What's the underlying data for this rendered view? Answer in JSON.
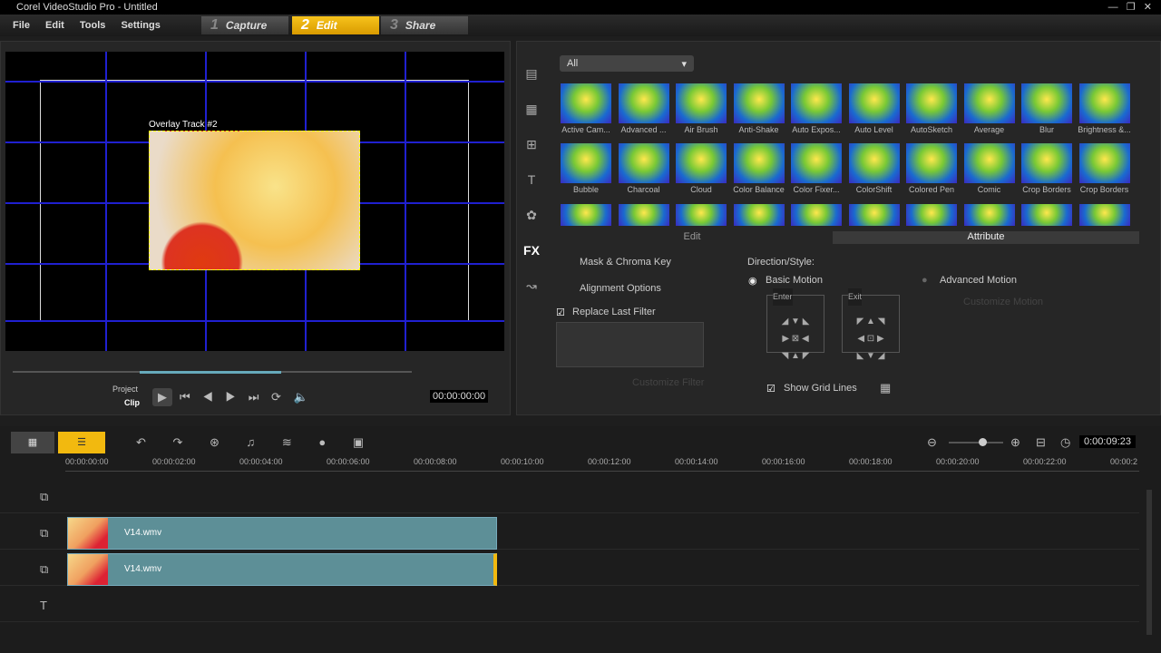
{
  "window": {
    "title": "Corel VideoStudio Pro - Untitled"
  },
  "menu": [
    "File",
    "Edit",
    "Tools",
    "Settings"
  ],
  "steps": [
    {
      "num": "1",
      "label": "Capture"
    },
    {
      "num": "2",
      "label": "Edit"
    },
    {
      "num": "3",
      "label": "Share"
    }
  ],
  "preview": {
    "overlay_label": "Overlay Track #2",
    "project_label": "Project",
    "clip_label": "Clip",
    "timecode": "00:00:00:00",
    "progress": 0.5
  },
  "library": {
    "filter": "All",
    "tab_edit": "Edit",
    "tab_attribute": "Attribute",
    "effects_row1": [
      "Active Cam...",
      "Advanced ...",
      "Air Brush",
      "Anti-Shake",
      "Auto Expos...",
      "Auto Level",
      "AutoSketch",
      "Average",
      "Blur",
      "Brightness &..."
    ],
    "effects_row2": [
      "Bubble",
      "Charcoal",
      "Cloud",
      "Color Balance",
      "Color Fixer...",
      "ColorShift",
      "Colored Pen",
      "Comic",
      "Crop Borders",
      "Crop Borders"
    ]
  },
  "attribute": {
    "mask": "Mask & Chroma Key",
    "alignment": "Alignment Options",
    "replace_last_filter": "Replace Last Filter",
    "customize_filter": "Customize Filter",
    "direction_style": "Direction/Style:",
    "basic_motion": "Basic Motion",
    "advanced_motion": "Advanced Motion",
    "customize_motion": "Customize Motion",
    "enter": "Enter",
    "exit": "Exit",
    "show_grid_lines": "Show Grid Lines"
  },
  "timeline": {
    "duration": "0:00:09:23",
    "ticks": [
      "00:00:00:00",
      "00:00:02:00",
      "00:00:04:00",
      "00:00:06:00",
      "00:00:08:00",
      "00:00:10:00",
      "00:00:12:00",
      "00:00:14:00",
      "00:00:16:00",
      "00:00:18:00",
      "00:00:20:00",
      "00:00:22:00",
      "00:00:2"
    ],
    "clips": [
      {
        "name": "V14.wmv"
      },
      {
        "name": "V14.wmv"
      }
    ]
  }
}
